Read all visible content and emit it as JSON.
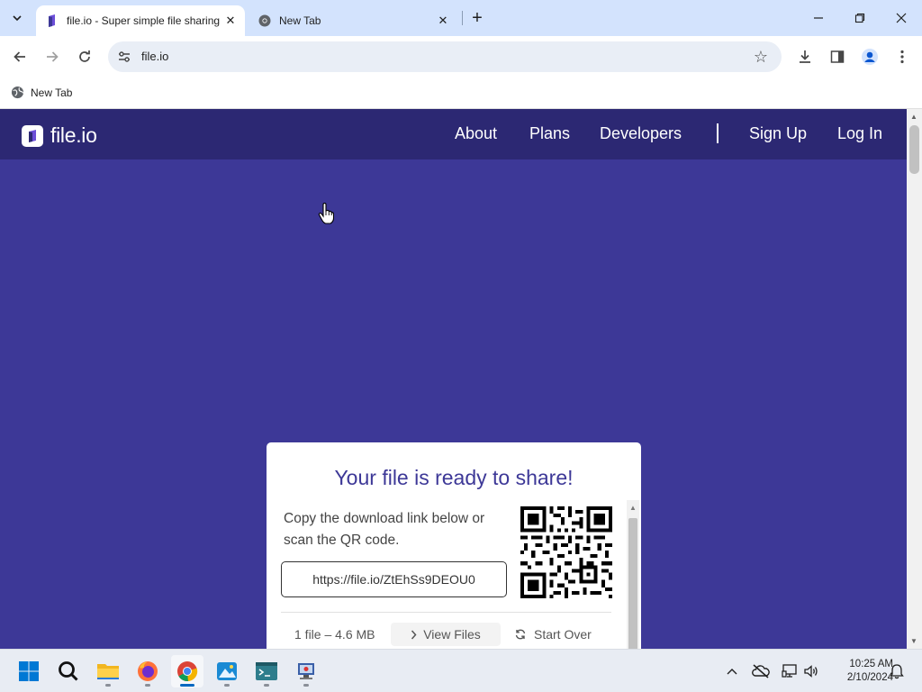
{
  "browser": {
    "tabs": [
      {
        "title": "file.io - Super simple file sharing",
        "active": true,
        "favicon": "fileio-favicon"
      },
      {
        "title": "New Tab",
        "active": false,
        "favicon": "chrome-favicon"
      }
    ],
    "url": "file.io",
    "bookmarks": [
      {
        "label": "New Tab",
        "icon": "globe-icon"
      }
    ]
  },
  "site": {
    "logo_text": "file.io",
    "nav": {
      "about": "About",
      "plans": "Plans",
      "developers": "Developers",
      "sign_up": "Sign Up",
      "log_in": "Log In"
    },
    "card": {
      "title": "Your file is ready to share!",
      "instructions": "Copy the download link below or scan the QR code.",
      "link": "https://file.io/ZtEhSs9DEOU0",
      "file_summary": "1 file – 4.6 MB",
      "view_files": "View Files",
      "start_over": "Start Over"
    }
  },
  "taskbar": {
    "apps": [
      "start-icon",
      "search-icon",
      "file-explorer-icon",
      "firefox-icon",
      "chrome-icon",
      "photos-icon",
      "terminal-icon",
      "network-manager-icon"
    ],
    "time": "10:25 AM",
    "date": "2/10/2024"
  },
  "colors": {
    "page_bg": "#3d3897",
    "nav_bg": "#2c2873",
    "title_color": "#3d3897",
    "tab_strip": "#d3e3fd"
  }
}
